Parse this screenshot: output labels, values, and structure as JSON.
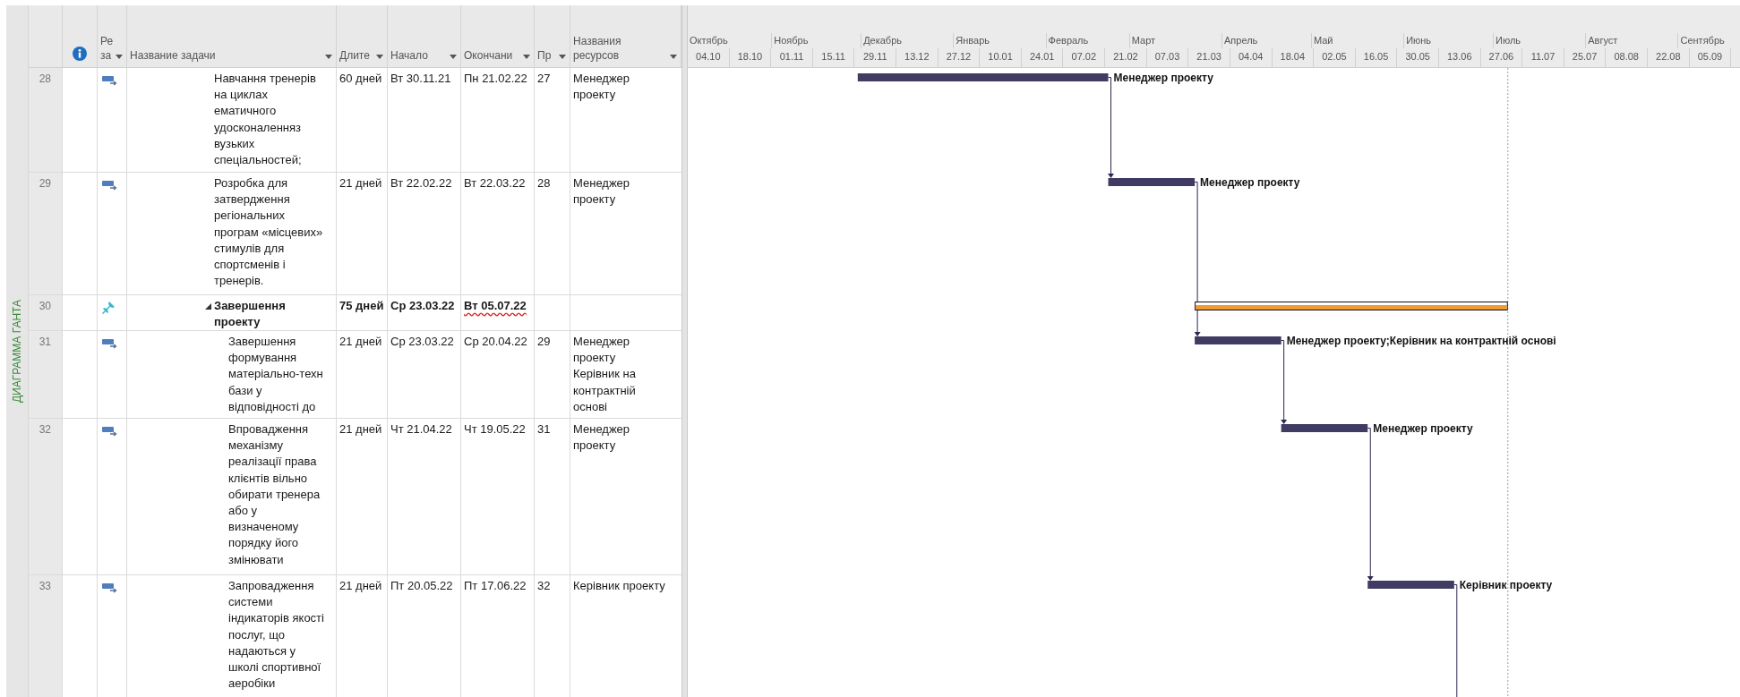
{
  "view_bar": {
    "label": "ДИАГРАММА ГАНТА"
  },
  "columns": [
    {
      "kind": "info"
    },
    {
      "kind": "text",
      "label": "Ре\nза"
    },
    {
      "kind": "text",
      "label": "Название задачи"
    },
    {
      "kind": "text",
      "label": "Длите"
    },
    {
      "kind": "text",
      "label": "Начало"
    },
    {
      "kind": "text",
      "label": "Окончани"
    },
    {
      "kind": "text",
      "label": "Пр"
    },
    {
      "kind": "text",
      "label": "Названия\nресурсов"
    }
  ],
  "timeline": {
    "months": [
      "Октябрь",
      "Ноябрь",
      "Декабрь",
      "Январь",
      "Февраль",
      "Март",
      "Апрель",
      "Май",
      "Июнь",
      "Июль",
      "Август",
      "Сентябрь"
    ],
    "weeks": [
      "04.10",
      "18.10",
      "01.11",
      "15.11",
      "29.11",
      "13.12",
      "27.12",
      "10.01",
      "24.01",
      "07.02",
      "21.02",
      "07.03",
      "21.03",
      "04.04",
      "18.04",
      "02.05",
      "16.05",
      "30.05",
      "13.06",
      "27.06",
      "11.07",
      "25.07",
      "08.08",
      "22.08",
      "05.09"
    ]
  },
  "tasks": [
    {
      "id": "28",
      "kind": "task",
      "manually_scheduled": false,
      "name": "Навчання тренерів\nна циклах\nематичного\nудосконаленняз\nвузьких\nспеціальностей;",
      "duration": "60 дней",
      "start": "Вт 30.11.21",
      "finish": "Пн 21.02.22",
      "finish_flagged": false,
      "predecessors": "27",
      "resources": "Менеджер\nпроекту",
      "bar_label": "Менеджер проекту"
    },
    {
      "id": "29",
      "kind": "task",
      "manually_scheduled": false,
      "name": "Розробка для\nзатвердження\nрегіональних\nпрограм «місцевих»\nстимулів для\nспортсменів і\nтренерів.",
      "duration": "21 дней",
      "start": "Вт 22.02.22",
      "finish": "Вт 22.03.22",
      "finish_flagged": false,
      "predecessors": "28",
      "resources": "Менеджер\nпроекту",
      "bar_label": "Менеджер проекту"
    },
    {
      "id": "30",
      "kind": "summary",
      "manually_scheduled": true,
      "name": "Завершення\nпроекту",
      "duration": "75 дней",
      "start": "Ср 23.03.22",
      "finish": "Вт 05.07.22",
      "finish_flagged": true,
      "expanded": true,
      "children": [
        {
          "id": "31",
          "kind": "task",
          "manually_scheduled": false,
          "name": "Завершення\nформування\nматеріально-техн\nбази у\nвідповідності до",
          "duration": "21 дней",
          "start": "Ср 23.03.22",
          "finish": "Ср 20.04.22",
          "finish_flagged": false,
          "predecessors": "29",
          "resources": "Менеджер\nпроекту\nКерівник на\nконтрактній\nоснові",
          "bar_label": "Менеджер проекту;Керівник на контрактній основі"
        },
        {
          "id": "32",
          "kind": "task",
          "manually_scheduled": false,
          "name": "Впровадження\nмеханізму\nреалізації права\nклієнтів вільно\nобирати тренера\nабо у\nвизначеному\nпорядку його\nзмінювати",
          "duration": "21 дней",
          "start": "Чт 21.04.22",
          "finish": "Чт 19.05.22",
          "finish_flagged": false,
          "predecessors": "31",
          "resources": "Менеджер\nпроекту",
          "bar_label": "Менеджер проекту"
        },
        {
          "id": "33",
          "kind": "task",
          "manually_scheduled": false,
          "name": "Запровадження\nсистеми\nіндикаторів якості\nпослуг, що\nнадаються у\nшколі спортивної\nаеробіки",
          "duration": "21 дней",
          "start": "Пт 20.05.22",
          "finish": "Пт 17.06.22",
          "finish_flagged": false,
          "predecessors": "32",
          "resources": "Керівник проекту",
          "bar_label": "Керівник проекту"
        }
      ]
    }
  ]
}
